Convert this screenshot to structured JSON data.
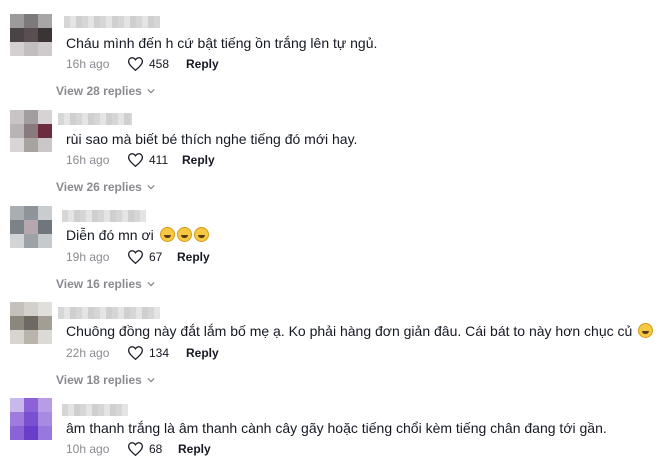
{
  "comments": [
    {
      "text": "Cháu mình đến h cứ bật tiếng ồn trắng lên tự ngủ.",
      "time": "16h ago",
      "likes": "458",
      "reply": "Reply",
      "view_replies": "View 28 replies"
    },
    {
      "text": "rùi sao mà biết bé thích nghe tiếng đó mới hay.",
      "time": "16h ago",
      "likes": "411",
      "reply": "Reply",
      "view_replies": "View 26 replies"
    },
    {
      "text": "Diễn đó mn ơi",
      "time": "19h ago",
      "likes": "67",
      "reply": "Reply",
      "view_replies": "View 16 replies"
    },
    {
      "text": "Chuông đồng này đắt lắm bố mẹ ạ. Ko phải hàng đơn giản đâu. Cái bát to này hơn chục củ",
      "time": "22h ago",
      "likes": "134",
      "reply": "Reply",
      "view_replies": "View 18 replies"
    },
    {
      "text": "âm thanh trắng là âm thanh cành cây gãy hoặc tiếng chổi kèm tiếng chân đang tới gần.",
      "time": "10h ago",
      "likes": "68",
      "reply": "Reply"
    }
  ],
  "icons": {
    "like": "heart-outline-icon",
    "expand": "chevron-down-icon",
    "emoji": "laughing-emoji-icon"
  },
  "colors": {
    "text": "#161823",
    "muted": "#8a8b91"
  }
}
